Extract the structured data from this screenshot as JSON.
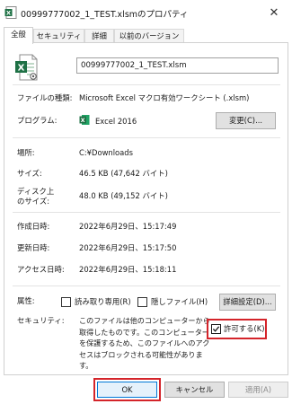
{
  "window": {
    "title": "00999777002_1_TEST.xlsmのプロパティ",
    "close_glyph": "✕"
  },
  "tabs": [
    {
      "label": "全般",
      "active": true
    },
    {
      "label": "セキュリティ",
      "active": false
    },
    {
      "label": "詳細",
      "active": false
    },
    {
      "label": "以前のバージョン",
      "active": false
    }
  ],
  "general": {
    "file_name": "00999777002_1_TEST.xlsm",
    "file_type_label": "ファイルの種類:",
    "file_type_value": "Microsoft Excel マクロ有効ワークシート (.xlsm)",
    "program_label": "プログラム:",
    "program_value": "Excel 2016",
    "change_button": "変更(C)...",
    "location_label": "場所:",
    "location_value": "C:¥Downloads",
    "size_label": "サイズ:",
    "size_value": "46.5 KB (47,642 バイト)",
    "size_on_disk_label_1": "ディスク上",
    "size_on_disk_label_2": "のサイズ:",
    "size_on_disk_value": "48.0 KB (49,152 バイト)",
    "created_label": "作成日時:",
    "created_value": "2022年6月29日、15:17:49",
    "modified_label": "更新日時:",
    "modified_value": "2022年6月29日、15:17:50",
    "accessed_label": "アクセス日時:",
    "accessed_value": "2022年6月29日、15:18:11",
    "attributes_label": "属性:",
    "readonly_label": "読み取り専用(R)",
    "readonly_checked": false,
    "hidden_label": "隠しファイル(H)",
    "hidden_checked": false,
    "advanced_button": "詳細設定(D)...",
    "security_label": "セキュリティ:",
    "security_text": "このファイルは他のコンピューターから取得したものです。このコンピューターを保護するため、このファイルへのアクセスはブロックされる可能性があります。",
    "allow_label": "許可する(K)",
    "allow_checked": true
  },
  "footer": {
    "ok": "OK",
    "cancel": "キャンセル",
    "apply": "適用(A)"
  },
  "colors": {
    "highlight": "#d4242a",
    "excel_green": "#1e7145",
    "ok_border": "#0078d7"
  },
  "icons": {
    "title": "excel-file-icon",
    "file": "excel-file-large-icon",
    "program": "excel-app-icon"
  }
}
